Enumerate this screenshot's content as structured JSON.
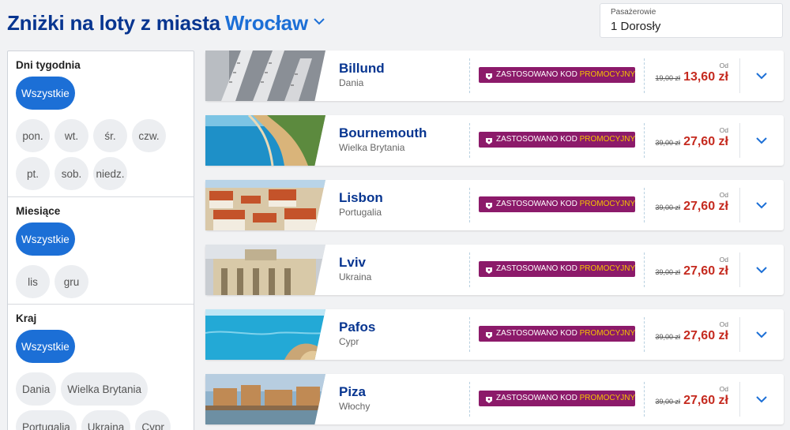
{
  "header": {
    "title_prefix": "Zniżki na loty z miasta",
    "city": "Wrocław",
    "passengers": {
      "label": "Pasażerowie",
      "value": "1 Dorosły"
    }
  },
  "filters": {
    "days": {
      "title": "Dni tygodnia",
      "all": "Wszystkie",
      "items": [
        "pon.",
        "wt.",
        "śr.",
        "czw.",
        "pt.",
        "sob.",
        "niedz."
      ]
    },
    "months": {
      "title": "Miesiące",
      "all": "Wszystkie",
      "items": [
        "lis",
        "gru"
      ]
    },
    "countries": {
      "title": "Kraj",
      "all": "Wszystkie",
      "items": [
        "Dania",
        "Wielka Brytania",
        "Portugalia",
        "Ukraina",
        "Cypr"
      ]
    }
  },
  "promo": {
    "prefix": "ZASTOSOWANO KOD ",
    "highlight": "PROMOCYJNY"
  },
  "price_from_label": "Od",
  "results": [
    {
      "name": "Billund",
      "country": "Dania",
      "old_price": "19,00 zł",
      "new_price": "13,60 zł",
      "image": "billund-architecture"
    },
    {
      "name": "Bournemouth",
      "country": "Wielka Brytania",
      "old_price": "39,00 zł",
      "new_price": "27,60 zł",
      "image": "coast-beach"
    },
    {
      "name": "Lisbon",
      "country": "Portugalia",
      "old_price": "39,00 zł",
      "new_price": "27,60 zł",
      "image": "rooftops"
    },
    {
      "name": "Lviv",
      "country": "Ukraina",
      "old_price": "39,00 zł",
      "new_price": "27,60 zł",
      "image": "opera-house"
    },
    {
      "name": "Pafos",
      "country": "Cypr",
      "old_price": "39,00 zł",
      "new_price": "27,60 zł",
      "image": "sea-rocks"
    },
    {
      "name": "Piza",
      "country": "Włochy",
      "old_price": "39,00 zł",
      "new_price": "27,60 zł",
      "image": "river-town"
    }
  ],
  "colors": {
    "navy": "#073590",
    "blue": "#1c6fd6",
    "promo_bg": "#8c1a6a",
    "promo_hl": "#f5c300",
    "price_red": "#c52a1f"
  }
}
